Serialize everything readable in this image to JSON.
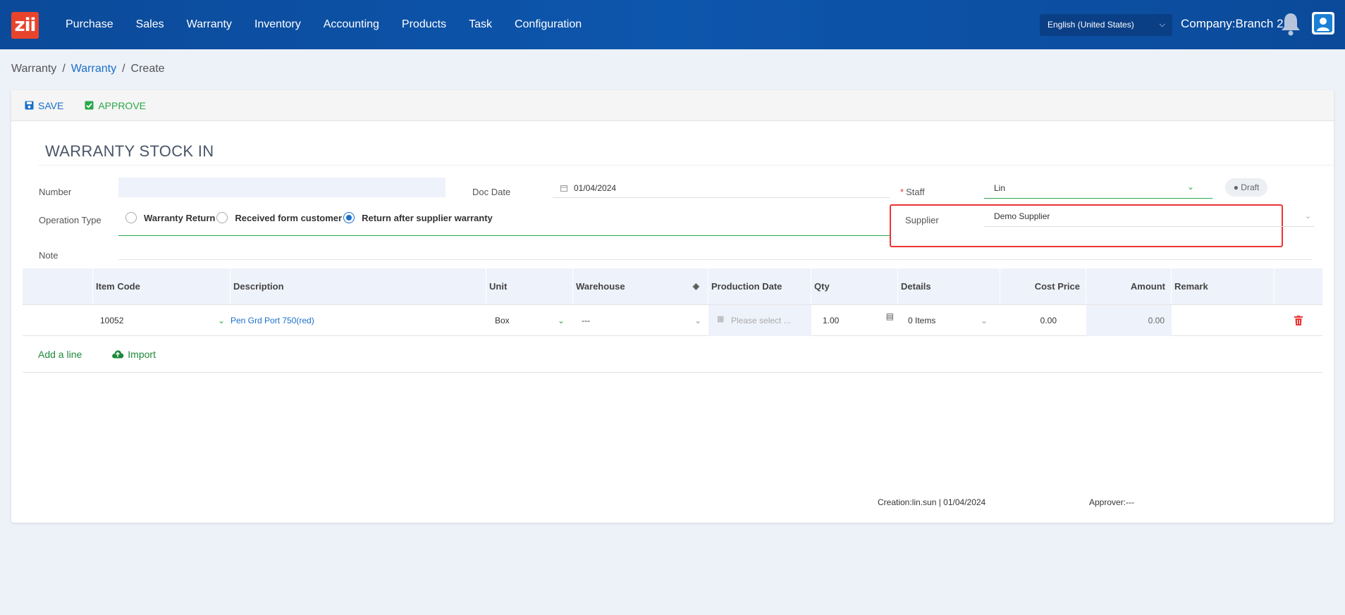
{
  "app": {
    "logo_text": "zii"
  },
  "nav": {
    "items": [
      "Purchase",
      "Sales",
      "Warranty",
      "Inventory",
      "Accounting",
      "Products",
      "Task",
      "Configuration"
    ]
  },
  "header": {
    "language": "English (United States)",
    "company": "Company:Branch 2"
  },
  "breadcrumb": {
    "root": "Warranty",
    "sep": "/",
    "parent": "Warranty",
    "current": "Create"
  },
  "toolbar": {
    "save_label": "SAVE",
    "approve_label": "APPROVE"
  },
  "form": {
    "title": "WARRANTY STOCK IN",
    "number_label": "Number",
    "number_value": "",
    "docdate_label": "Doc Date",
    "docdate_value": "01/04/2024",
    "staff_label": "Staff",
    "staff_value": "Lin",
    "status": "Draft",
    "operation_label": "Operation Type",
    "operation_options": [
      "Warranty Return",
      "Received form customer",
      "Return after supplier warranty"
    ],
    "operation_selected": "Return after supplier warranty",
    "supplier_label": "Supplier",
    "supplier_value": "Demo Supplier",
    "note_label": "Note"
  },
  "table": {
    "headers": [
      "",
      "Item Code",
      "Description",
      "Unit",
      "Warehouse",
      "Production Date",
      "Qty",
      "Details",
      "Cost Price",
      "Amount",
      "Remark",
      ""
    ],
    "row": {
      "item_code": "10052",
      "description": "Pen Grd Port 750(red)",
      "unit": "Box",
      "warehouse": "---",
      "production_date_placeholder": "Please select ...",
      "qty": "1.00",
      "details": "0 Items",
      "cost_price": "0.00",
      "amount": "0.00",
      "remark": ""
    },
    "add_line": "Add a line",
    "import": "Import"
  },
  "footer": {
    "creation": "Creation:lin.sun | 01/04/2024",
    "approver": "Approver:---"
  },
  "colors": {
    "nav": "#0d56ad",
    "accent_green": "#2aa84a",
    "link_blue": "#1a6fc9",
    "highlight_red": "#e33333"
  }
}
